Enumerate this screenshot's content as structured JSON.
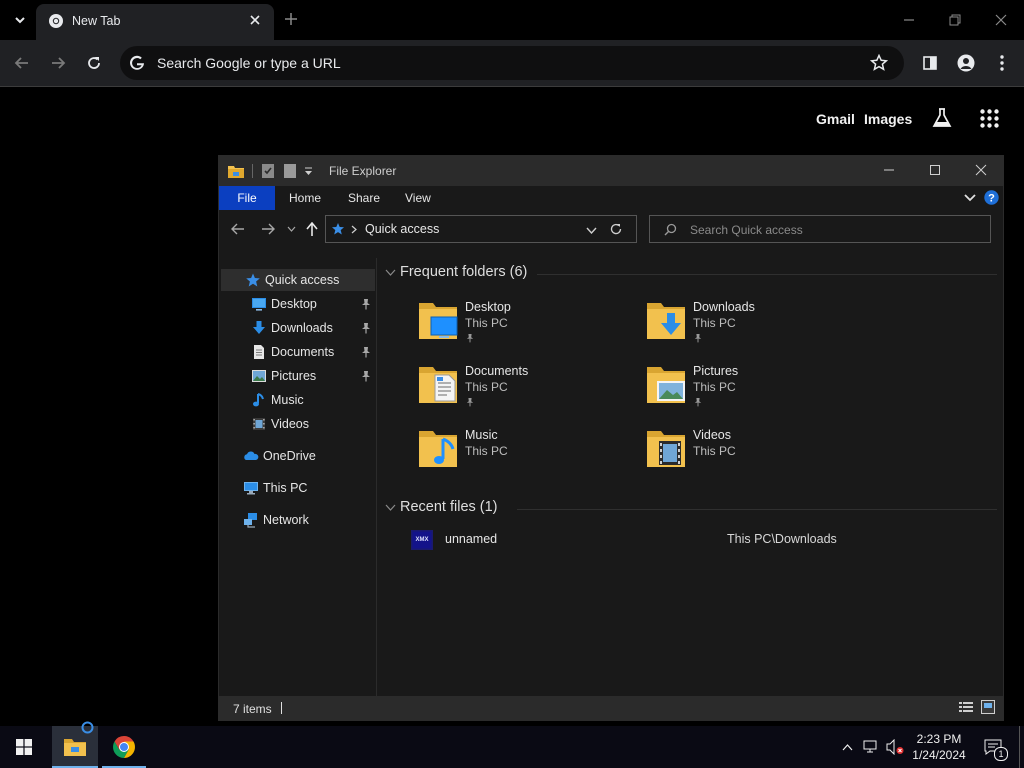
{
  "browser": {
    "tab_title": "New Tab",
    "omnibox_placeholder": "Search Google or type a URL",
    "links": {
      "gmail": "Gmail",
      "images": "Images"
    }
  },
  "explorer": {
    "window_title": "File Explorer",
    "ribbon_tabs": [
      "File",
      "Home",
      "Share",
      "View"
    ],
    "address_path": "Quick access",
    "search_placeholder": "Search Quick access",
    "sidebar": {
      "quick_access": "Quick access",
      "pinned": [
        {
          "label": "Desktop",
          "icon": "desktop-icon",
          "pinned": true
        },
        {
          "label": "Downloads",
          "icon": "downloads-icon",
          "pinned": true
        },
        {
          "label": "Documents",
          "icon": "documents-icon",
          "pinned": true
        },
        {
          "label": "Pictures",
          "icon": "pictures-icon",
          "pinned": true
        },
        {
          "label": "Music",
          "icon": "music-icon",
          "pinned": false
        },
        {
          "label": "Videos",
          "icon": "videos-icon",
          "pinned": false
        }
      ],
      "onedrive": "OneDrive",
      "this_pc": "This PC",
      "network": "Network"
    },
    "frequent_header": "Frequent folders (6)",
    "frequent": [
      {
        "name": "Desktop",
        "location": "This PC",
        "pinned": true,
        "overlay": "desktop"
      },
      {
        "name": "Downloads",
        "location": "This PC",
        "pinned": true,
        "overlay": "downloads"
      },
      {
        "name": "Documents",
        "location": "This PC",
        "pinned": true,
        "overlay": "documents"
      },
      {
        "name": "Pictures",
        "location": "This PC",
        "pinned": true,
        "overlay": "pictures"
      },
      {
        "name": "Music",
        "location": "This PC",
        "pinned": false,
        "overlay": "music"
      },
      {
        "name": "Videos",
        "location": "This PC",
        "pinned": false,
        "overlay": "videos"
      }
    ],
    "recent_header": "Recent files (1)",
    "recent": [
      {
        "name": "unnamed",
        "path": "This PC\\Downloads"
      }
    ],
    "status_items": "7 items"
  },
  "taskbar": {
    "time": "2:23 PM",
    "date": "1/24/2024",
    "notification_count": "1"
  },
  "colors": {
    "file_tab": "#0b3fc0",
    "folder_yellow": "#f2c14e",
    "accent_blue": "#1e90ff"
  }
}
